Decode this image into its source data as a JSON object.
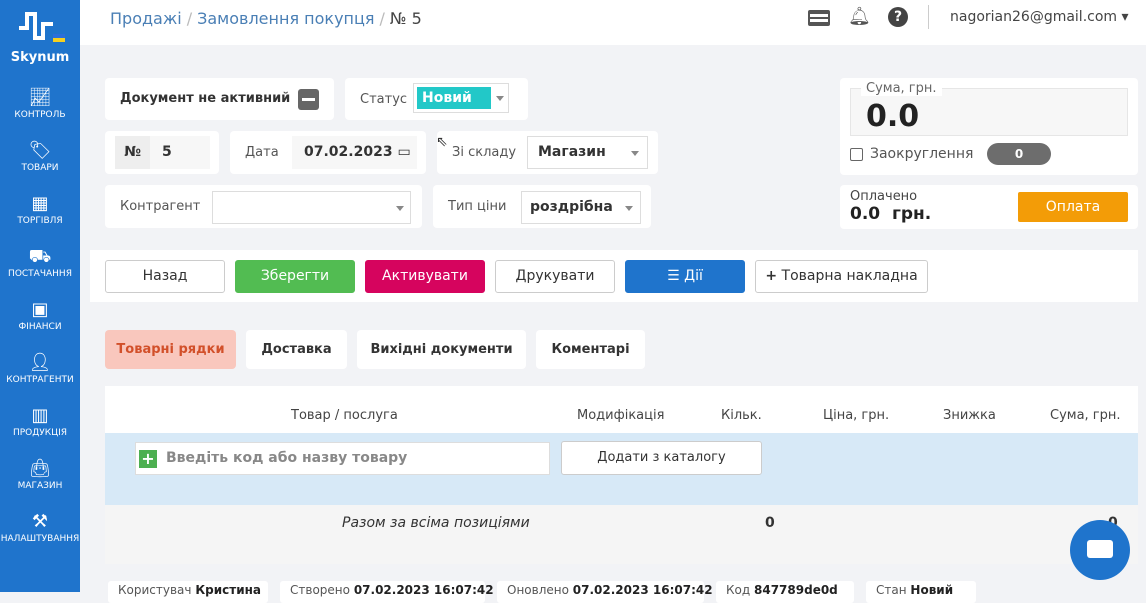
{
  "brand": "Skynum",
  "sidebar": [
    {
      "label": "КОНТРОЛЬ",
      "icon": "chart-icon"
    },
    {
      "label": "ТОВАРИ",
      "icon": "tag-icon"
    },
    {
      "label": "ТОРГІВЛЯ",
      "icon": "cash-register-icon"
    },
    {
      "label": "ПОСТАЧАННЯ",
      "icon": "truck-icon"
    },
    {
      "label": "ФІНАНСИ",
      "icon": "wallet-icon"
    },
    {
      "label": "КОНТРАГЕНТИ",
      "icon": "user-icon"
    },
    {
      "label": "ПРОДУКЦІЯ",
      "icon": "factory-icon"
    },
    {
      "label": "МАГАЗИН",
      "icon": "shop-bag-icon"
    },
    {
      "label": "НАЛАШТУВАННЯ",
      "icon": "tools-icon"
    }
  ],
  "breadcrumb": {
    "a": "Продажі",
    "b": "Замовлення покупця",
    "c": "№ 5",
    "sep": "/"
  },
  "user": {
    "email": "nagorian26@gmail.com"
  },
  "doc": {
    "inactive_label": "Документ не активний",
    "status_label": "Статус",
    "status_value": "Новий",
    "num_label": "№",
    "num_value": "5",
    "date_label": "Дата",
    "date_value": "07.02.2023",
    "warehouse_label": "Зі складу",
    "warehouse_value": "Магазин",
    "contractor_label": "Контрагент",
    "contractor_value": "",
    "price_type_label": "Тип ціни",
    "price_type_value": "роздрібна"
  },
  "sum": {
    "label": "Сума, грн.",
    "value": "0.0",
    "rounding_label": "Заокруглення",
    "rounding_value": "0",
    "paid_label": "Оплачено",
    "paid_value": "0.0  грн.",
    "pay_button": "Оплата"
  },
  "toolbar": {
    "back": "Назад",
    "save": "Зберегти",
    "activate": "Активувати",
    "print": "Друкувати",
    "actions": "Дії",
    "invoice": "Товарна накладна"
  },
  "tabs": [
    "Товарні рядки",
    "Доставка",
    "Вихідні документи",
    "Коментарі"
  ],
  "table": {
    "headers": [
      "Товар / послуга",
      "Модифікація",
      "Кільк.",
      "Ціна, грн.",
      "Знижка",
      "Сума, грн."
    ],
    "input_placeholder": "Введіть код або назву товару",
    "catalog_button": "Додати з каталогу",
    "total_label": "Разом за всіма позиціями",
    "total_qty": "0",
    "total_sum": "0"
  },
  "footer": [
    {
      "k": "Користувач",
      "v": "Кристина"
    },
    {
      "k": "Створено",
      "v": "07.02.2023 16:07:42"
    },
    {
      "k": "Оновлено",
      "v": "07.02.2023 16:07:42"
    },
    {
      "k": "Код",
      "v": "847789de0d"
    },
    {
      "k": "Стан",
      "v": "Новий"
    }
  ],
  "colors": {
    "sidebar": "#1f74cc",
    "save": "#52bc52",
    "activate": "#d6045e",
    "actions": "#1f74cc",
    "pay": "#f39c07",
    "status": "#22c8c8",
    "active_tab": "#f9c7bd"
  }
}
